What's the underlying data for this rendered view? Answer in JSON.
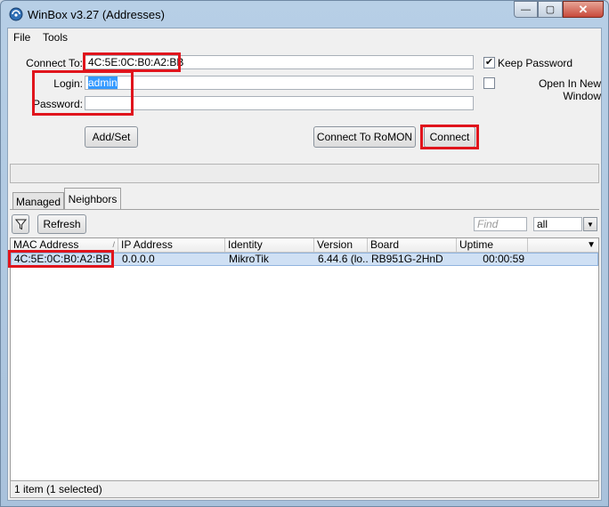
{
  "window": {
    "title": "WinBox v3.27 (Addresses)",
    "controls": {
      "minimize": "—",
      "maximize": "▢",
      "close": "✕"
    }
  },
  "menu": {
    "file": "File",
    "tools": "Tools"
  },
  "connect_form": {
    "connect_to_label": "Connect To:",
    "connect_to_value": "4C:5E:0C:B0:A2:BB",
    "login_label": "Login:",
    "login_value": "admin",
    "password_label": "Password:",
    "password_value": "",
    "keep_password_label": "Keep Password",
    "keep_password_checked": true,
    "open_new_window_label": "Open In New Window",
    "open_new_window_checked": false,
    "add_set_label": "Add/Set",
    "connect_romon_label": "Connect To RoMON",
    "connect_label": "Connect"
  },
  "tabs": [
    {
      "label": "Managed",
      "active": false
    },
    {
      "label": "Neighbors",
      "active": true
    }
  ],
  "toolbar": {
    "filter_icon": "funnel-icon",
    "refresh_label": "Refresh",
    "find_placeholder": "Find",
    "filter_value": "all",
    "dropdown_icon": "▼"
  },
  "table": {
    "columns": [
      "MAC Address",
      "IP Address",
      "Identity",
      "Version",
      "Board",
      "Uptime"
    ],
    "rows": [
      {
        "mac": "4C:5E:0C:B0:A2:BB",
        "ip": "0.0.0.0",
        "identity": "MikroTik",
        "version": "6.44.6 (lo...",
        "board": "RB951G-2HnD",
        "uptime": "00:00:59",
        "selected": true
      }
    ]
  },
  "status": {
    "text": "1 item (1 selected)"
  },
  "colors": {
    "highlight_box": "#e0141c",
    "selection": "#3399ff",
    "row_selected": "#cfe0f4"
  }
}
